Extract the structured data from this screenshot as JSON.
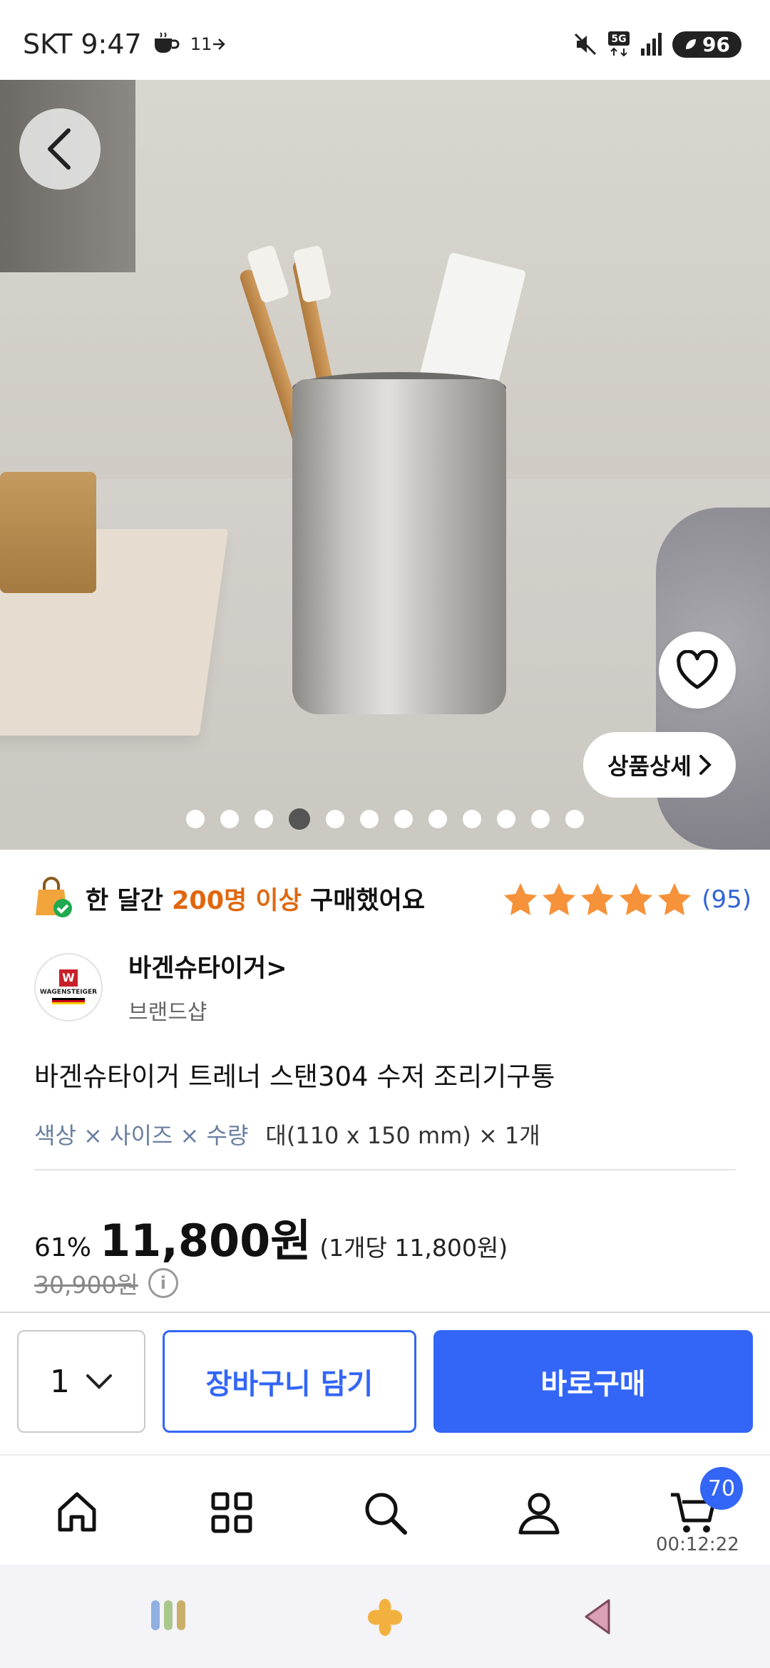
{
  "status_bar": {
    "carrier_time": "SKT 9:47",
    "notif_count": "11",
    "battery": "96"
  },
  "hero": {
    "detail_label": "상품상세",
    "page_count": 12,
    "active_page": 4
  },
  "social_proof": {
    "prefix": "한 달간",
    "highlight": "200명 이상",
    "suffix": "구매했어요"
  },
  "rating": {
    "stars": 5,
    "count": "(95)"
  },
  "brand": {
    "name": "바겐슈타이거",
    "chevron": ">",
    "subtitle": "브랜드샵",
    "logo_text": "WAGENSTEIGER"
  },
  "product": {
    "title": "바겐슈타이거 트레너 스탠304 수저 조리기구통",
    "option_label": "색상 × 사이즈 × 수량",
    "option_value": "대(110 x 150 mm) × 1개"
  },
  "price": {
    "discount": "61%",
    "sale": "11,800원",
    "per_unit": "(1개당 11,800원)",
    "original": "30,900원"
  },
  "actions": {
    "quantity": "1",
    "add_to_cart": "장바구니 담기",
    "buy_now": "바로구매"
  },
  "nav": {
    "cart_badge": "70",
    "timer": "00:12:22"
  },
  "colors": {
    "accent": "#3366f6",
    "highlight": "#e0670f",
    "star": "#f5923a"
  }
}
